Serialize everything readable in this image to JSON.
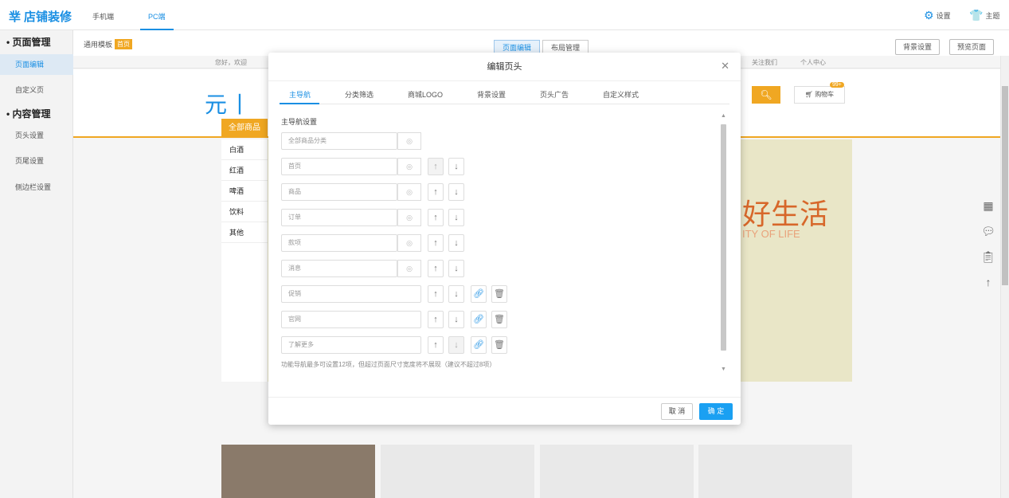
{
  "topbar": {
    "brand": "店铺装修",
    "tabs": [
      "手机端",
      "PC端"
    ],
    "settings_label": "设置",
    "theme_label": "主题"
  },
  "sidebar": {
    "group1": "页面管理",
    "group1_items": [
      "页面编辑",
      "自定义页"
    ],
    "group2": "内容管理",
    "group2_items": [
      "页头设置",
      "页尾设置",
      "侧边栏设置"
    ]
  },
  "main": {
    "template_label": "通用模板",
    "template_badge": "首页",
    "mode_tabs": [
      "页面编辑",
      "布局管理"
    ],
    "bg_settings_button": "背景设置",
    "preview_button": "预览页面"
  },
  "preview": {
    "topstrip_left": "您好，欢迎",
    "topstrip_links": [
      "关注我们",
      "个人中心"
    ],
    "cart_label": "购物车",
    "cart_badge": "99+",
    "all_products": "全部商品",
    "categories": [
      "白酒",
      "红酒",
      "啤酒",
      "饮料",
      "其他"
    ],
    "banner_text": "好生活",
    "banner_sub": "ITY OF LIFE"
  },
  "modal": {
    "title": "编辑页头",
    "tabs": [
      "主导航",
      "分类筛选",
      "商城LOGO",
      "背景设置",
      "页头广告",
      "自定义样式"
    ],
    "section_title": "主导航设置",
    "nav_rows": [
      {
        "placeholder": "全部商品分类"
      },
      {
        "placeholder": "首页"
      },
      {
        "placeholder": "商品"
      },
      {
        "placeholder": "订单"
      },
      {
        "placeholder": "款项"
      },
      {
        "placeholder": "消息"
      },
      {
        "placeholder": "促销"
      },
      {
        "placeholder": "官网"
      },
      {
        "placeholder": "了解更多"
      }
    ],
    "hint": "功能导航最多可设置12项，但超过页面尺寸宽度将不展现（建议不超过8项）",
    "cancel": "取 消",
    "confirm": "确 定"
  }
}
